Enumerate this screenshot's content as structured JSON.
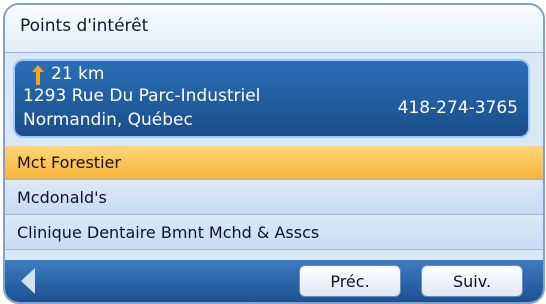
{
  "header": {
    "title": "Points d'intérêt"
  },
  "info": {
    "distance": "21 km",
    "address_line1": "1293 Rue Du Parc-Industriel",
    "address_line2": "Normandin, Québec",
    "phone": "418-274-3765",
    "arrow_icon": "up-arrow-icon",
    "arrow_color": "#f5a623"
  },
  "list": {
    "items": [
      {
        "label": "Mct Forestier",
        "selected": true
      },
      {
        "label": "Mcdonald's",
        "selected": false
      },
      {
        "label": "Clinique Dentaire Bmnt Mchd & Asscs",
        "selected": false
      }
    ]
  },
  "footer": {
    "back_icon": "left-triangle-icon",
    "prev_label": "Préc.",
    "next_label": "Suiv."
  },
  "colors": {
    "selected_row": "#f7b338",
    "panel_blue": "#1d4f8f"
  }
}
